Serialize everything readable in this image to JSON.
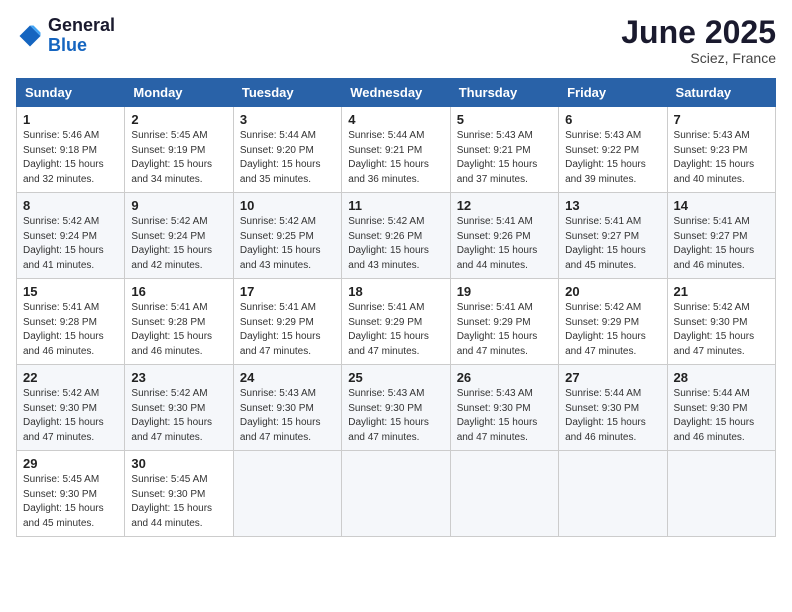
{
  "header": {
    "logo_line1": "General",
    "logo_line2": "Blue",
    "month_title": "June 2025",
    "location": "Sciez, France"
  },
  "weekdays": [
    "Sunday",
    "Monday",
    "Tuesday",
    "Wednesday",
    "Thursday",
    "Friday",
    "Saturday"
  ],
  "weeks": [
    [
      {
        "day": "1",
        "sunrise": "Sunrise: 5:46 AM",
        "sunset": "Sunset: 9:18 PM",
        "daylight": "Daylight: 15 hours and 32 minutes."
      },
      {
        "day": "2",
        "sunrise": "Sunrise: 5:45 AM",
        "sunset": "Sunset: 9:19 PM",
        "daylight": "Daylight: 15 hours and 34 minutes."
      },
      {
        "day": "3",
        "sunrise": "Sunrise: 5:44 AM",
        "sunset": "Sunset: 9:20 PM",
        "daylight": "Daylight: 15 hours and 35 minutes."
      },
      {
        "day": "4",
        "sunrise": "Sunrise: 5:44 AM",
        "sunset": "Sunset: 9:21 PM",
        "daylight": "Daylight: 15 hours and 36 minutes."
      },
      {
        "day": "5",
        "sunrise": "Sunrise: 5:43 AM",
        "sunset": "Sunset: 9:21 PM",
        "daylight": "Daylight: 15 hours and 37 minutes."
      },
      {
        "day": "6",
        "sunrise": "Sunrise: 5:43 AM",
        "sunset": "Sunset: 9:22 PM",
        "daylight": "Daylight: 15 hours and 39 minutes."
      },
      {
        "day": "7",
        "sunrise": "Sunrise: 5:43 AM",
        "sunset": "Sunset: 9:23 PM",
        "daylight": "Daylight: 15 hours and 40 minutes."
      }
    ],
    [
      {
        "day": "8",
        "sunrise": "Sunrise: 5:42 AM",
        "sunset": "Sunset: 9:24 PM",
        "daylight": "Daylight: 15 hours and 41 minutes."
      },
      {
        "day": "9",
        "sunrise": "Sunrise: 5:42 AM",
        "sunset": "Sunset: 9:24 PM",
        "daylight": "Daylight: 15 hours and 42 minutes."
      },
      {
        "day": "10",
        "sunrise": "Sunrise: 5:42 AM",
        "sunset": "Sunset: 9:25 PM",
        "daylight": "Daylight: 15 hours and 43 minutes."
      },
      {
        "day": "11",
        "sunrise": "Sunrise: 5:42 AM",
        "sunset": "Sunset: 9:26 PM",
        "daylight": "Daylight: 15 hours and 43 minutes."
      },
      {
        "day": "12",
        "sunrise": "Sunrise: 5:41 AM",
        "sunset": "Sunset: 9:26 PM",
        "daylight": "Daylight: 15 hours and 44 minutes."
      },
      {
        "day": "13",
        "sunrise": "Sunrise: 5:41 AM",
        "sunset": "Sunset: 9:27 PM",
        "daylight": "Daylight: 15 hours and 45 minutes."
      },
      {
        "day": "14",
        "sunrise": "Sunrise: 5:41 AM",
        "sunset": "Sunset: 9:27 PM",
        "daylight": "Daylight: 15 hours and 46 minutes."
      }
    ],
    [
      {
        "day": "15",
        "sunrise": "Sunrise: 5:41 AM",
        "sunset": "Sunset: 9:28 PM",
        "daylight": "Daylight: 15 hours and 46 minutes."
      },
      {
        "day": "16",
        "sunrise": "Sunrise: 5:41 AM",
        "sunset": "Sunset: 9:28 PM",
        "daylight": "Daylight: 15 hours and 46 minutes."
      },
      {
        "day": "17",
        "sunrise": "Sunrise: 5:41 AM",
        "sunset": "Sunset: 9:29 PM",
        "daylight": "Daylight: 15 hours and 47 minutes."
      },
      {
        "day": "18",
        "sunrise": "Sunrise: 5:41 AM",
        "sunset": "Sunset: 9:29 PM",
        "daylight": "Daylight: 15 hours and 47 minutes."
      },
      {
        "day": "19",
        "sunrise": "Sunrise: 5:41 AM",
        "sunset": "Sunset: 9:29 PM",
        "daylight": "Daylight: 15 hours and 47 minutes."
      },
      {
        "day": "20",
        "sunrise": "Sunrise: 5:42 AM",
        "sunset": "Sunset: 9:29 PM",
        "daylight": "Daylight: 15 hours and 47 minutes."
      },
      {
        "day": "21",
        "sunrise": "Sunrise: 5:42 AM",
        "sunset": "Sunset: 9:30 PM",
        "daylight": "Daylight: 15 hours and 47 minutes."
      }
    ],
    [
      {
        "day": "22",
        "sunrise": "Sunrise: 5:42 AM",
        "sunset": "Sunset: 9:30 PM",
        "daylight": "Daylight: 15 hours and 47 minutes."
      },
      {
        "day": "23",
        "sunrise": "Sunrise: 5:42 AM",
        "sunset": "Sunset: 9:30 PM",
        "daylight": "Daylight: 15 hours and 47 minutes."
      },
      {
        "day": "24",
        "sunrise": "Sunrise: 5:43 AM",
        "sunset": "Sunset: 9:30 PM",
        "daylight": "Daylight: 15 hours and 47 minutes."
      },
      {
        "day": "25",
        "sunrise": "Sunrise: 5:43 AM",
        "sunset": "Sunset: 9:30 PM",
        "daylight": "Daylight: 15 hours and 47 minutes."
      },
      {
        "day": "26",
        "sunrise": "Sunrise: 5:43 AM",
        "sunset": "Sunset: 9:30 PM",
        "daylight": "Daylight: 15 hours and 47 minutes."
      },
      {
        "day": "27",
        "sunrise": "Sunrise: 5:44 AM",
        "sunset": "Sunset: 9:30 PM",
        "daylight": "Daylight: 15 hours and 46 minutes."
      },
      {
        "day": "28",
        "sunrise": "Sunrise: 5:44 AM",
        "sunset": "Sunset: 9:30 PM",
        "daylight": "Daylight: 15 hours and 46 minutes."
      }
    ],
    [
      {
        "day": "29",
        "sunrise": "Sunrise: 5:45 AM",
        "sunset": "Sunset: 9:30 PM",
        "daylight": "Daylight: 15 hours and 45 minutes."
      },
      {
        "day": "30",
        "sunrise": "Sunrise: 5:45 AM",
        "sunset": "Sunset: 9:30 PM",
        "daylight": "Daylight: 15 hours and 44 minutes."
      },
      null,
      null,
      null,
      null,
      null
    ]
  ]
}
